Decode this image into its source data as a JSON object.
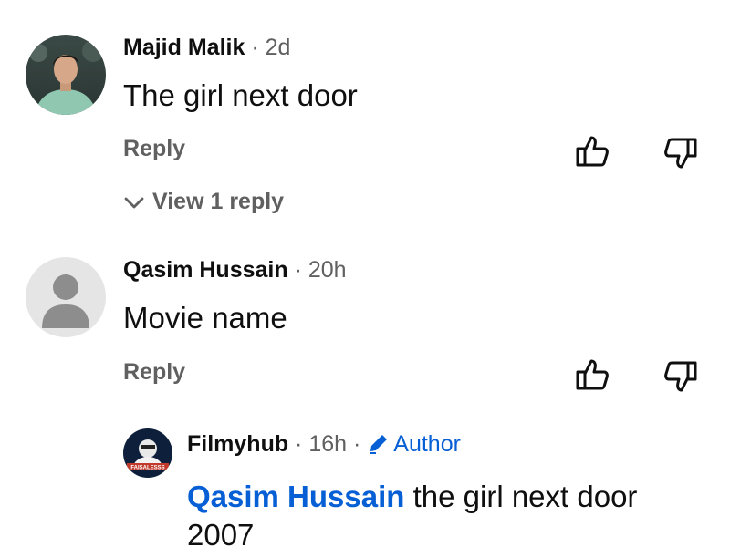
{
  "comments": [
    {
      "author": "Majid Malik",
      "time": "2d",
      "text": "The girl next door",
      "reply_label": "Reply",
      "view_replies_label": "View 1 reply"
    },
    {
      "author": "Qasim Hussain",
      "time": "20h",
      "text": "Movie name",
      "reply_label": "Reply"
    }
  ],
  "reply": {
    "author": "Filmyhub",
    "time": "16h",
    "author_badge": "Author",
    "mention": "Qasim Hussain",
    "text_line1": " the girl next door",
    "text_line2": "2007",
    "avatar_text": "FAISALESSS"
  },
  "icons": {
    "like": "thumbs-up-icon",
    "dislike": "thumbs-down-icon",
    "chevron": "chevron-down-icon",
    "pencil": "pencil-icon"
  },
  "colors": {
    "link_blue": "#065fd4",
    "secondary_text": "#606060"
  }
}
